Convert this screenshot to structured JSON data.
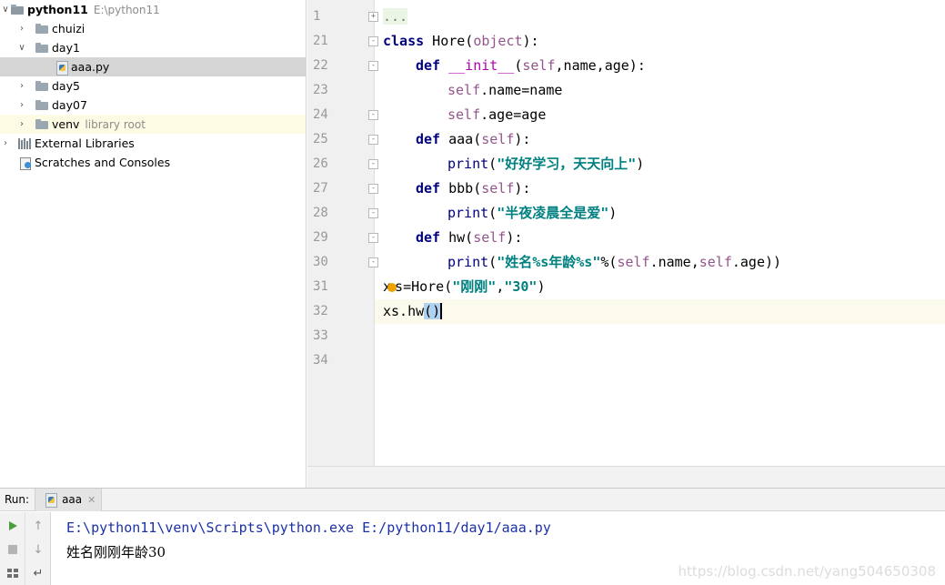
{
  "project_tree": {
    "root": {
      "name": "python11",
      "path": "E:\\python11"
    },
    "items": [
      {
        "label": "chuizi"
      },
      {
        "label": "day1"
      },
      {
        "label": "aaa.py"
      },
      {
        "label": "day5"
      },
      {
        "label": "day07"
      },
      {
        "label": "venv",
        "note": "library root"
      }
    ],
    "external_libraries": "External Libraries",
    "scratches": "Scratches and Consoles"
  },
  "editor": {
    "line_numbers": [
      "1",
      "21",
      "22",
      "23",
      "24",
      "25",
      "26",
      "27",
      "28",
      "29",
      "30",
      "31",
      "32",
      "33",
      "34"
    ],
    "code": {
      "l1_dots": "...",
      "l21_kw": "class",
      "l21_name": " Hore(",
      "l21_base": "object",
      "l21_end": "):",
      "l22_kw": "def",
      "l22_fn": "__init__",
      "l22_a": "(",
      "l22_self": "self",
      "l22_b": ",name,age):",
      "l23_self": "self",
      "l23_b": ".name=name",
      "l24_self": "self",
      "l24_b": ".age=age",
      "l25_kw": "def",
      "l25_a": " aaa(",
      "l25_self": "self",
      "l25_b": "):",
      "l26_fn": "print",
      "l26_a": "(",
      "l26_str": "\"好好学习，天天向上\"",
      "l26_b": ")",
      "l27_kw": "def",
      "l27_a": " bbb(",
      "l27_self": "self",
      "l27_b": "):",
      "l28_fn": "print",
      "l28_a": "(",
      "l28_str": "\"半夜凌晨全是爱\"",
      "l28_b": ")",
      "l29_kw": "def",
      "l29_a": " hw(",
      "l29_self": "self",
      "l29_b": "):",
      "l30_fn": "print",
      "l30_a": "(",
      "l30_str": "\"姓名%s年龄%s\"",
      "l30_b": "%(",
      "l30_self1": "self",
      "l30_c": ".name,",
      "l30_self2": "self",
      "l30_d": ".age))",
      "l31_a": "x",
      "l31_b": "s",
      "l31_c": "=Hore(",
      "l31_str1": "\"刚刚\"",
      "l31_comma": ",",
      "l31_str2": "\"30\"",
      "l31_d": ")",
      "l32_a": "xs.hw",
      "l32_b": "()"
    }
  },
  "run": {
    "label": "Run:",
    "tab": "aaa",
    "output": [
      "E:\\python11\\venv\\Scripts\\python.exe E:/python11/day1/aaa.py",
      "姓名刚刚年龄30"
    ],
    "watermark": "https://blog.csdn.net/yang504650308"
  },
  "colors": {
    "keyword": "#000080",
    "self": "#94558d",
    "string": "#008080",
    "current_line": "#fcfaed"
  }
}
